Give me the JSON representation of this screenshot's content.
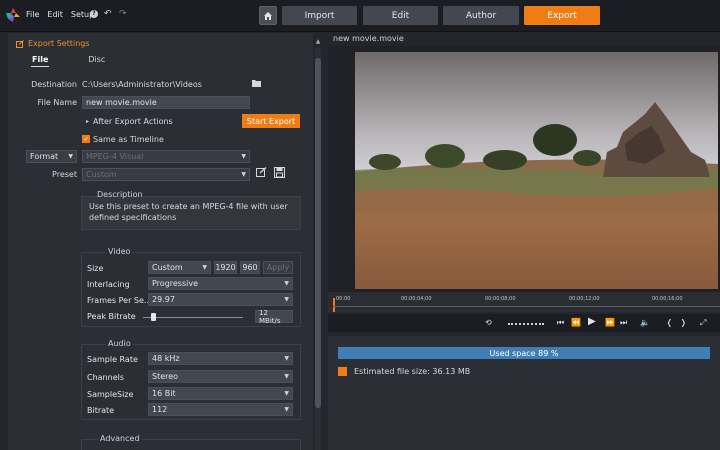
{
  "menu": {
    "file": "File",
    "edit": "Edit",
    "setup": "Setup"
  },
  "tabs": [
    {
      "label": "Import"
    },
    {
      "label": "Edit"
    },
    {
      "label": "Author"
    },
    {
      "label": "Export",
      "active": true
    }
  ],
  "panel": {
    "title": "Export Settings",
    "subtabs": [
      "File",
      "Disc"
    ],
    "destination_label": "Destination",
    "destination_value": "C:\\Users\\Administrator\\Videos",
    "filename_label": "File Name",
    "filename_value": "new movie.movie",
    "after_export": "After Export Actions",
    "start_export": "Start Export",
    "same_as_timeline": "Same as Timeline",
    "format_label": "Format",
    "format_value": "MPEG-4 Visual",
    "preset_label": "Preset",
    "preset_value": "Custom",
    "description_title": "Description",
    "description_text": "Use this preset to create an MPEG-4 file with user defined specifications"
  },
  "video": {
    "group_title": "Video",
    "size_label": "Size",
    "size_value": "Custom",
    "width": "1920",
    "height": "960",
    "apply": "Apply",
    "interlacing_label": "Interlacing",
    "interlacing_value": "Progressive",
    "fps_label": "Frames Per Se...",
    "fps_value": "29.97",
    "peak_label": "Peak Bitrate",
    "peak_value": "12 MBit/s",
    "peak_level": 0.08
  },
  "audio": {
    "group_title": "Audio",
    "rate_label": "Sample Rate",
    "rate_value": "48 kHz",
    "channels_label": "Channels",
    "channels_value": "Stereo",
    "samplesize_label": "SampleSize",
    "samplesize_value": "16 Bit",
    "bitrate_label": "Bitrate",
    "bitrate_value": "112"
  },
  "advanced": {
    "group_title": "Advanced"
  },
  "viewer": {
    "title": "new movie.movie",
    "ruler": [
      "00:00",
      "00;00;04;00",
      "00;00;08;00",
      "00;00;12;00",
      "00;00;16;00"
    ]
  },
  "status": {
    "used_space": "Used space 89 %",
    "used_fraction": 0.89,
    "estimated": "Estimated file size: 36.13 MB"
  },
  "colors": {
    "accent": "#f07c14",
    "bar": "#3f7fb6"
  }
}
